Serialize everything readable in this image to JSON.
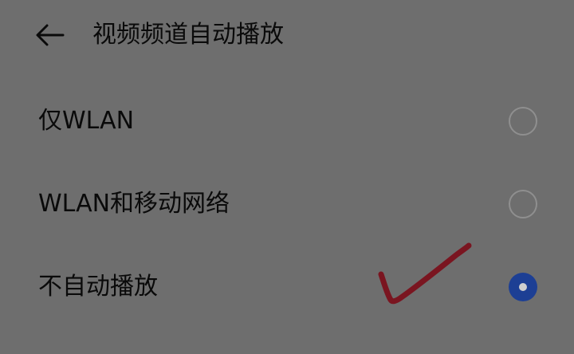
{
  "header": {
    "back_icon": "arrow-left-icon",
    "title": "视频频道自动播放"
  },
  "options": [
    {
      "label": "仅WLAN",
      "selected": false
    },
    {
      "label": "WLAN和移动网络",
      "selected": false
    },
    {
      "label": "不自动播放",
      "selected": true
    }
  ],
  "colors": {
    "background": "#6e6e6e",
    "text": "#0a0a0a",
    "radio_selected": "#1d3f94",
    "radio_unselected_border": "#8f8f8f",
    "annotation_checkmark": "#7a1520"
  }
}
